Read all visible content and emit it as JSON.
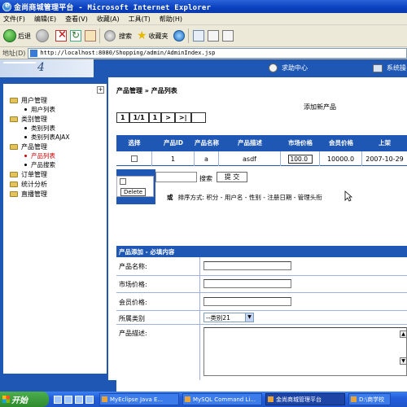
{
  "window": {
    "title": "金尚商城管理平台 - Microsoft Internet Explorer"
  },
  "menubar": [
    "文件(F)",
    "编辑(E)",
    "查看(V)",
    "收藏(A)",
    "工具(T)",
    "帮助(H)"
  ],
  "toolbar": {
    "back": "后退",
    "search": "搜索",
    "favorites": "收藏夹"
  },
  "address": {
    "label": "地址(D)",
    "url": "http://localhost:8080/Shopping/admin/AdminIndex.jsp"
  },
  "banner": {
    "logo_text": "4",
    "help": "求助中心",
    "system": "系统操"
  },
  "sidebar": {
    "groups": [
      {
        "label": "用户管理",
        "items": [
          "用户列表"
        ]
      },
      {
        "label": "类别管理",
        "items": [
          "类别列表",
          "类别列表AJAX"
        ]
      },
      {
        "label": "产品管理",
        "items": [
          "产品列表",
          "产品搜索"
        ]
      },
      {
        "label": "订单管理",
        "items": []
      },
      {
        "label": "统计分析",
        "items": []
      },
      {
        "label": "直播管理",
        "items": []
      }
    ],
    "active_item": "产品列表"
  },
  "main": {
    "breadcrumb": "产品管理 » 产品列表",
    "add_link": "添加新产品",
    "pager": [
      "1",
      "1/1",
      "1",
      ">",
      ">|"
    ],
    "table": {
      "headers": [
        "选择",
        "产品ID",
        "产品名称",
        "产品描述",
        "市场价格",
        "会员价格",
        "上架"
      ],
      "rows": [
        {
          "id": "1",
          "name": "a",
          "desc": "asdf",
          "market_price": "100.0",
          "member_price": "10000.0",
          "date": "2007-10-29"
        }
      ]
    },
    "delete_button": "Delete",
    "search_label": "搜索",
    "submit_button": "提 交",
    "sort_prefix": "或",
    "sort_text": "排序方式: 积分 - 用户名 - 性别 - 注册日期 - 管理头衔"
  },
  "form": {
    "title": "产品添加 - 必填内容",
    "fields": [
      "产品名称:",
      "市场价格:",
      "会员价格:",
      "所属类别",
      "产品描述:"
    ],
    "category_value": "--类别21"
  },
  "taskbar": {
    "start": "开始",
    "tasks": [
      "MyEclipse Java E...",
      "MySQL Command Li...",
      "金尚商城管理平台",
      "D:\\商学校"
    ],
    "active_task": "金尚商城管理平台"
  }
}
